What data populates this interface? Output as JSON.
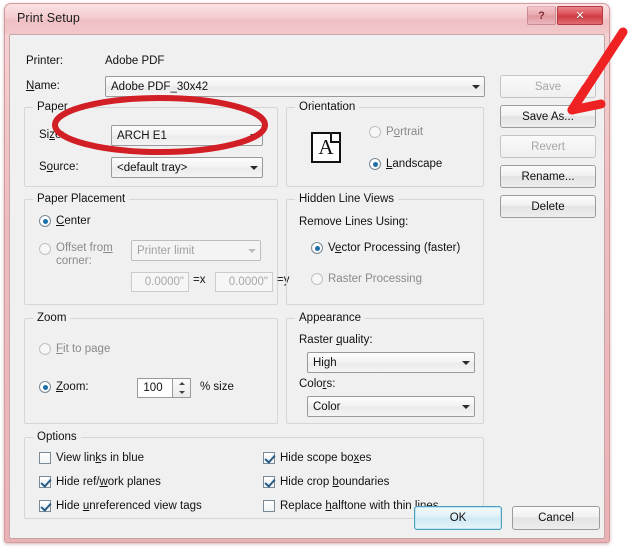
{
  "window": {
    "title": "Print Setup",
    "help_button": "?",
    "close_button": "✕"
  },
  "printer": {
    "printer_label": "Printer:",
    "printer_value": "Adobe PDF",
    "name_label": "Name:",
    "name_value": "Adobe PDF_30x42"
  },
  "printer_buttons": [
    {
      "label": "Save",
      "enabled": false
    },
    {
      "label": "Save As...",
      "enabled": true
    },
    {
      "label": "Revert",
      "enabled": false
    },
    {
      "label": "Rename...",
      "enabled": true
    },
    {
      "label": "Delete",
      "enabled": true
    }
  ],
  "paper": {
    "group_title": "Paper",
    "size_label": "Size:",
    "size_value": "ARCH E1",
    "source_label": "Source:",
    "source_value": "<default tray>"
  },
  "orientation": {
    "group_title": "Orientation",
    "icon_letter": "A",
    "portrait_label": "Portrait",
    "portrait_selected": false,
    "landscape_label": "Landscape",
    "landscape_selected": true
  },
  "paper_placement": {
    "group_title": "Paper Placement",
    "center_label": "Center",
    "center_selected": true,
    "offset_label_line1": "Offset from",
    "offset_label_line2": "corner:",
    "offset_selected": false,
    "offset_combo_value": "Printer limit",
    "offset_x_value": "0.0000\"",
    "offset_x_suffix": "=x",
    "offset_y_value": "0.0000\"",
    "offset_y_suffix": "=y"
  },
  "hidden_line_views": {
    "group_title": "Hidden Line Views",
    "remove_lines_label": "Remove Lines Using:",
    "vector_label": "Vector Processing (faster)",
    "vector_selected": true,
    "raster_label": "Raster Processing",
    "raster_selected": false
  },
  "zoom": {
    "group_title": "Zoom",
    "fit_to_page_label": "Fit to page",
    "fit_to_page_selected": false,
    "zoom_label": "Zoom:",
    "zoom_selected": true,
    "zoom_value": "100",
    "percent_suffix": "% size"
  },
  "appearance": {
    "group_title": "Appearance",
    "raster_quality_label": "Raster quality:",
    "raster_quality_value": "High",
    "colors_label": "Colors:",
    "colors_value": "Color"
  },
  "options": {
    "group_title": "Options",
    "left_column": [
      {
        "label": "View links in blue",
        "checked": false
      },
      {
        "label": "Hide ref/work planes",
        "checked": true
      },
      {
        "label": "Hide unreferenced view tags",
        "checked": true
      }
    ],
    "right_column": [
      {
        "label": "Hide scope boxes",
        "checked": true
      },
      {
        "label": "Hide crop boundaries",
        "checked": true
      },
      {
        "label": "Replace halftone with thin lines",
        "checked": false
      }
    ]
  },
  "footer": {
    "ok_label": "OK",
    "cancel_label": "Cancel"
  },
  "annotations": {
    "ellipse_color": "#d21f26",
    "arrow_color": "#ee2222",
    "ellipse_target": "paper-size-combo",
    "arrow_target": "save-as-button"
  }
}
